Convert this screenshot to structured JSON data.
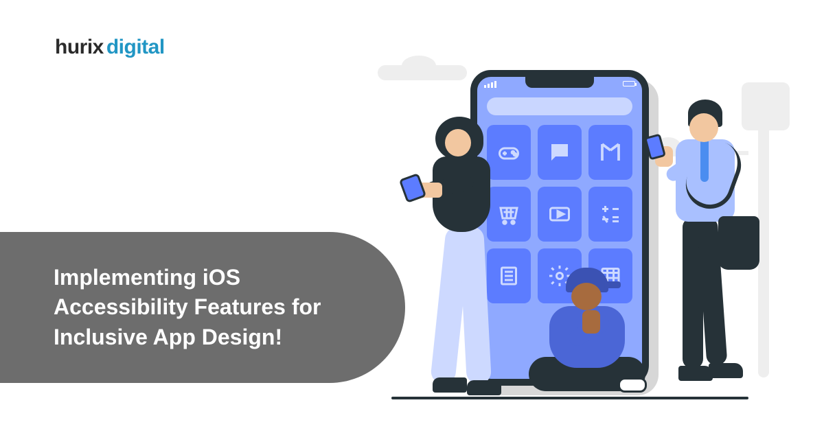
{
  "logo": {
    "part1": "hurix",
    "part2": "digital"
  },
  "title": "Implementing iOS Accessibility Features for Inclusive App Design!",
  "colors": {
    "brand_dark": "#2b2b2b",
    "brand_accent": "#2196c4",
    "banner_bg": "#6d6d6d",
    "phone_accent": "#5c7cff"
  },
  "illustration": {
    "app_icons": [
      "game-controller-icon",
      "chat-icon",
      "music-icon",
      "cart-icon",
      "video-icon",
      "calculator-icon",
      "doc-icon",
      "gear-icon",
      "calendar-icon"
    ],
    "people": [
      "woman-leaning",
      "person-sitting",
      "man-standing"
    ]
  }
}
